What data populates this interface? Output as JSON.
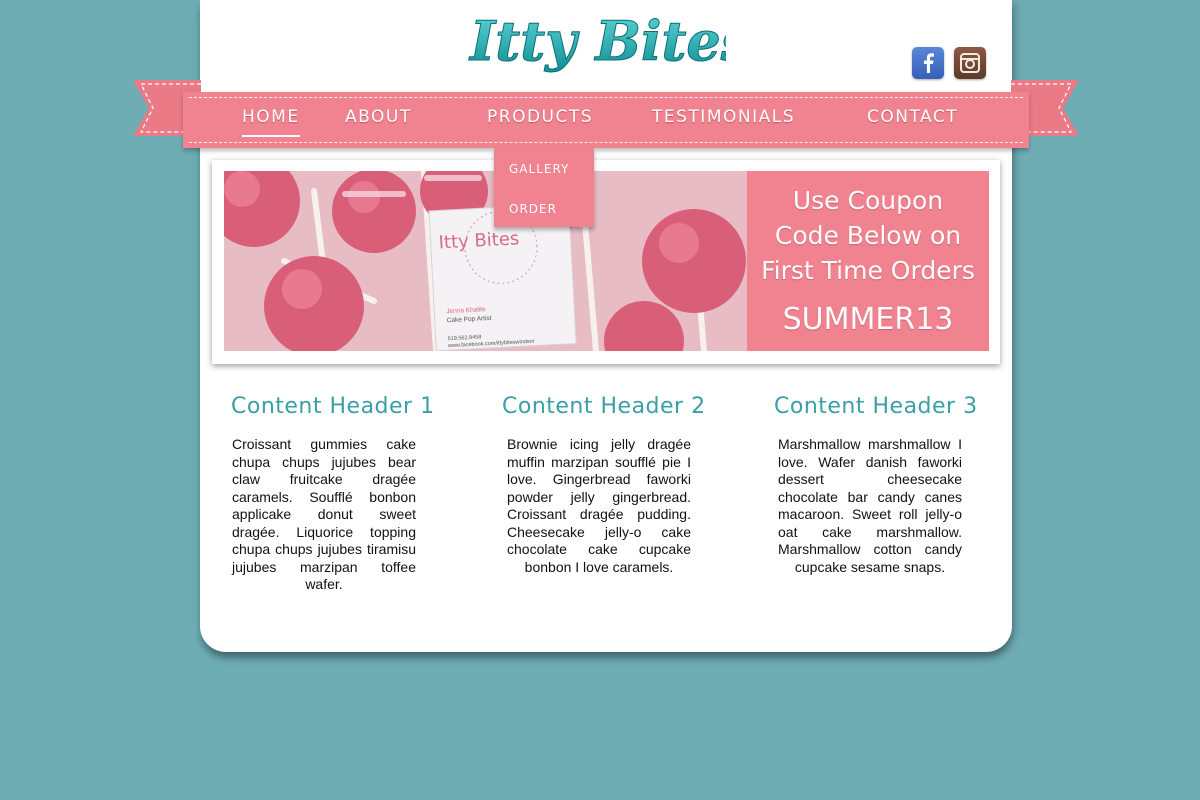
{
  "brand": {
    "logo_text": "Itty Bites"
  },
  "social": [
    {
      "name": "facebook",
      "icon": "facebook-icon"
    },
    {
      "name": "instagram",
      "icon": "instagram-icon"
    }
  ],
  "nav": {
    "items": [
      "HOME",
      "ABOUT",
      "PRODUCTS",
      "TESTIMONIALS",
      "CONTACT"
    ],
    "active": "HOME",
    "products_dropdown": [
      "GALLERY",
      "ORDER"
    ]
  },
  "banner": {
    "card_title": "Itty Bites",
    "card_name": "Jenna Khalife",
    "card_role": "Cake Pop Artist",
    "card_phone": "519.562.9458",
    "card_url": "www.facebook.com/ittybiteswindsor",
    "coupon_lines": [
      "Use Coupon",
      "Code Below on",
      "First Time Orders"
    ],
    "coupon_code": "SUMMER13"
  },
  "columns": [
    {
      "header": "Content Header 1",
      "body": "Croissant gummies cake chupa chups jujubes bear claw fruitcake dragée caramels. Soufflé bonbon applicake donut sweet dragée. Liquorice topping chupa chups jujubes tiramisu jujubes marzipan toffee wafer."
    },
    {
      "header": "Content Header 2",
      "body": "Brownie icing jelly dragée muffin marzipan soufflé pie I love. Gingerbread faworki powder jelly gingerbread. Croissant dragée pudding. Cheesecake jelly-o cake chocolate cake cupcake bonbon I love caramels."
    },
    {
      "header": "Content Header 3",
      "body": "Marshmallow marshmallow I love. Wafer danish faworki dessert cheesecake chocolate bar candy canes macaroon. Sweet roll jelly-o oat cake marshmallow. Marshmallow cotton candy cupcake sesame snaps."
    }
  ],
  "colors": {
    "background": "#6fadb4",
    "ribbon_pink": "#f0838f",
    "logo_teal": "#1aa9ad",
    "header_teal": "#3aa0a6"
  }
}
